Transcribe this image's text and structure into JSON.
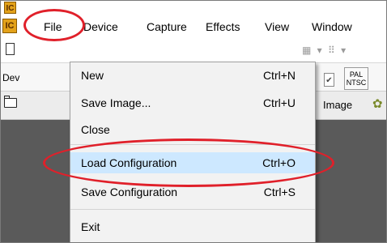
{
  "app": {
    "icon_letter": "IC"
  },
  "menubar": {
    "items": [
      {
        "label": "File"
      },
      {
        "label": "Device"
      },
      {
        "label": "Capture"
      },
      {
        "label": "Effects"
      },
      {
        "label": "View"
      },
      {
        "label": "Window"
      }
    ]
  },
  "toolbar": {
    "device_label_partial": "Dev",
    "pal_label": "PAL",
    "ntsc_label": "NTSC",
    "image_label": "Image"
  },
  "file_menu": {
    "items": [
      {
        "label": "New",
        "shortcut": "Ctrl+N"
      },
      {
        "label": "Save Image...",
        "shortcut": "Ctrl+U"
      },
      {
        "label": "Close",
        "shortcut": ""
      },
      {
        "label": "Load Configuration",
        "shortcut": "Ctrl+O",
        "highlighted": true
      },
      {
        "label": "Save Configuration",
        "shortcut": "Ctrl+S"
      },
      {
        "label": "Exit",
        "shortcut": ""
      }
    ]
  },
  "colors": {
    "annotation": "#e0202a",
    "menu_highlight": "#cde8ff",
    "menu_background": "#f2f2f2"
  }
}
